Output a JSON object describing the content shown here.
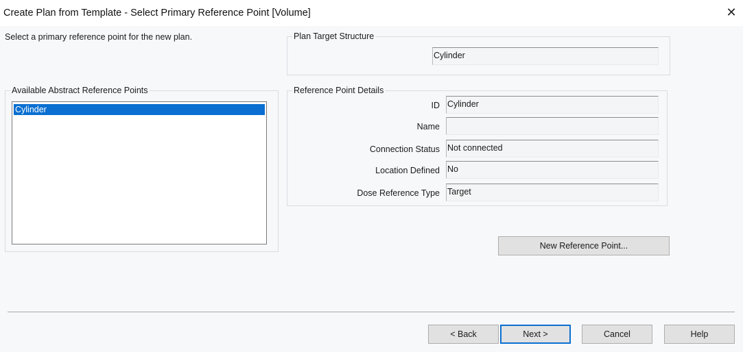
{
  "window": {
    "title": "Create Plan from Template - Select Primary Reference Point [Volume]",
    "close_glyph": "✕"
  },
  "instruction": "Select a primary reference point for the new plan.",
  "target_structure": {
    "group_title": "Plan Target Structure",
    "value": "Cylinder"
  },
  "available_points": {
    "group_title": "Available Abstract Reference Points",
    "items": [
      "Cylinder"
    ],
    "selected_index": 0
  },
  "details": {
    "group_title": "Reference Point Details",
    "fields": [
      {
        "label": "ID",
        "value": "Cylinder"
      },
      {
        "label": "Name",
        "value": ""
      },
      {
        "label": "Connection Status",
        "value": "Not connected"
      },
      {
        "label": "Location Defined",
        "value": "No"
      },
      {
        "label": "Dose Reference Type",
        "value": "Target"
      }
    ]
  },
  "new_point_button": "New Reference Point...",
  "footer": {
    "back": "< Back",
    "next": "Next >",
    "cancel": "Cancel",
    "help": "Help"
  },
  "colors": {
    "selection": "#0a6fd1",
    "default_button_border": "#0a6fd1",
    "window_bg": "#f7f8fa"
  }
}
